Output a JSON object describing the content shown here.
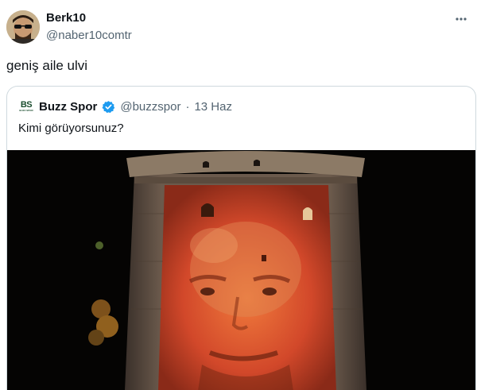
{
  "tweet": {
    "author": {
      "display_name": "Berk10",
      "handle": "@naber10comtr"
    },
    "text": "geniş aile ulvi",
    "more_icon": "more-horizontal-icon"
  },
  "quoted_tweet": {
    "logo_text": "BS",
    "logo_subtext": "BUZZ SPOR",
    "author": {
      "display_name": "Buzz Spor",
      "handle": "@buzzspor"
    },
    "separator": "·",
    "date": "13 Haz",
    "text": "Kimi görüyorsunuz?",
    "verified_color": "#1d9bf0"
  }
}
